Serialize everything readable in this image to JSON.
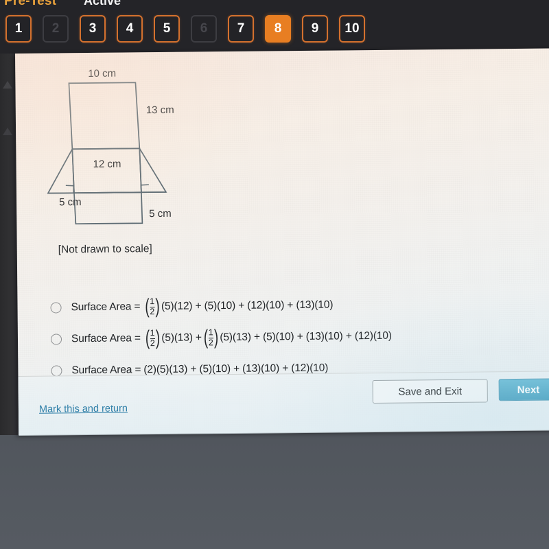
{
  "header": {
    "test_name": "Pre-Test",
    "status": "Active",
    "tabs": [
      {
        "label": "1",
        "state": "available"
      },
      {
        "label": "2",
        "state": "disabled"
      },
      {
        "label": "3",
        "state": "available"
      },
      {
        "label": "4",
        "state": "available"
      },
      {
        "label": "5",
        "state": "available"
      },
      {
        "label": "6",
        "state": "disabled"
      },
      {
        "label": "7",
        "state": "available"
      },
      {
        "label": "8",
        "state": "current"
      },
      {
        "label": "9",
        "state": "available"
      },
      {
        "label": "10",
        "state": "available"
      }
    ]
  },
  "figure": {
    "labels": {
      "top": "10 cm",
      "right": "13 cm",
      "middle": "12 cm",
      "bottom_left": "5 cm",
      "bottom_right": "5 cm"
    },
    "caption": "[Not drawn to scale]"
  },
  "options": [
    {
      "lead": "Surface Area =",
      "has_fraction_1": true,
      "numerator": "1",
      "denominator": "2",
      "tail": "(5)(12) + (5)(10) + (12)(10) + (13)(10)",
      "selected": false
    },
    {
      "lead": "Surface Area =",
      "has_fraction_1": true,
      "numerator": "1",
      "denominator": "2",
      "mid": "(5)(13) +",
      "has_fraction_2": true,
      "numerator2": "1",
      "denominator2": "2",
      "tail": "(5)(13) + (5)(10) + (13)(10) + (12)(10)",
      "selected": false
    },
    {
      "lead": "Surface Area =",
      "has_fraction_1": false,
      "tail": "(2)(5)(13) + (5)(10) + (13)(10) + (12)(10)",
      "selected": false
    }
  ],
  "footer": {
    "mark_link": "Mark this and return",
    "save_button": "Save and Exit",
    "next_button": "Next"
  },
  "colors": {
    "accent_orange": "#e87e22",
    "tab_border": "#d4712e",
    "link_blue": "#2f7fa8",
    "next_button": "#3e9cbd",
    "header_bg": "#242428",
    "page_bg": "#f3f1ee",
    "figure_stroke": "#5d6b73"
  }
}
